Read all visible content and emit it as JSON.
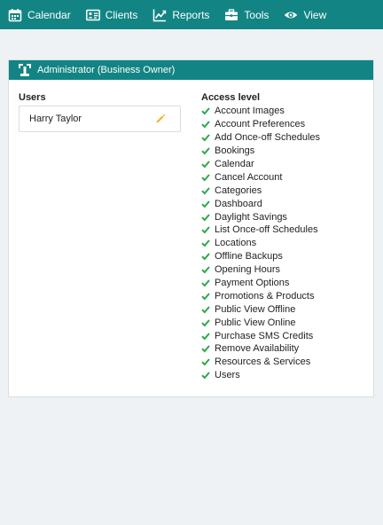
{
  "nav": {
    "items": [
      {
        "label": "Calendar",
        "icon": "calendar-icon"
      },
      {
        "label": "Clients",
        "icon": "id-card-icon"
      },
      {
        "label": "Reports",
        "icon": "chart-line-icon"
      },
      {
        "label": "Tools",
        "icon": "toolbox-icon"
      },
      {
        "label": "View",
        "icon": "eye-icon"
      }
    ]
  },
  "panel": {
    "title": "Administrator (Business Owner)",
    "icon": "admin-role-icon"
  },
  "users": {
    "heading": "Users",
    "list": [
      {
        "name": "Harry Taylor"
      }
    ]
  },
  "access": {
    "heading": "Access level",
    "permissions": [
      "Account Images",
      "Account Preferences",
      "Add Once-off Schedules",
      "Bookings",
      "Calendar",
      "Cancel Account",
      "Categories",
      "Dashboard",
      "Daylight Savings",
      "List Once-off Schedules",
      "Locations",
      "Offline Backups",
      "Opening Hours",
      "Payment Options",
      "Promotions & Products",
      "Public View Offline",
      "Public View Online",
      "Purchase SMS Credits",
      "Remove Availability",
      "Resources & Services",
      "Users"
    ]
  },
  "colors": {
    "brand": "#138484",
    "check": "#2ea84a",
    "edit": "#f0b429",
    "background": "#eef2f4"
  }
}
